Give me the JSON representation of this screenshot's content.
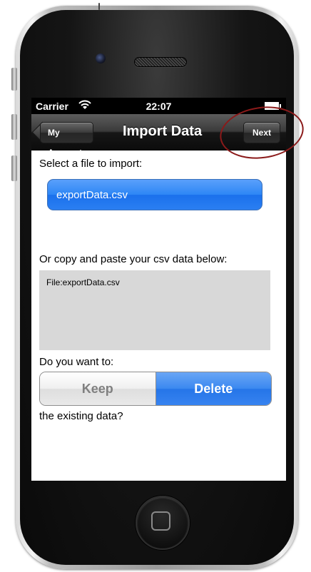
{
  "status_bar": {
    "carrier": "Carrier",
    "wifi_icon": "wifi-icon",
    "time": "22:07",
    "battery_icon": "battery-icon"
  },
  "nav_bar": {
    "back_label": "My Accounts",
    "title": "Import Data",
    "next_label": "Next"
  },
  "content": {
    "select_label": "Select a file to import:",
    "selected_file": "exportData.csv",
    "paste_label": "Or copy and paste your csv data below:",
    "csv_text": "File:exportData.csv",
    "question_label": "Do you want to:",
    "segments": [
      {
        "label": "Keep",
        "selected": false
      },
      {
        "label": "Delete",
        "selected": true
      }
    ],
    "trailing_label": "the existing data?"
  },
  "colors": {
    "accent_blue": "#2b7ff2",
    "annotation_ring": "#8b1a1a"
  }
}
